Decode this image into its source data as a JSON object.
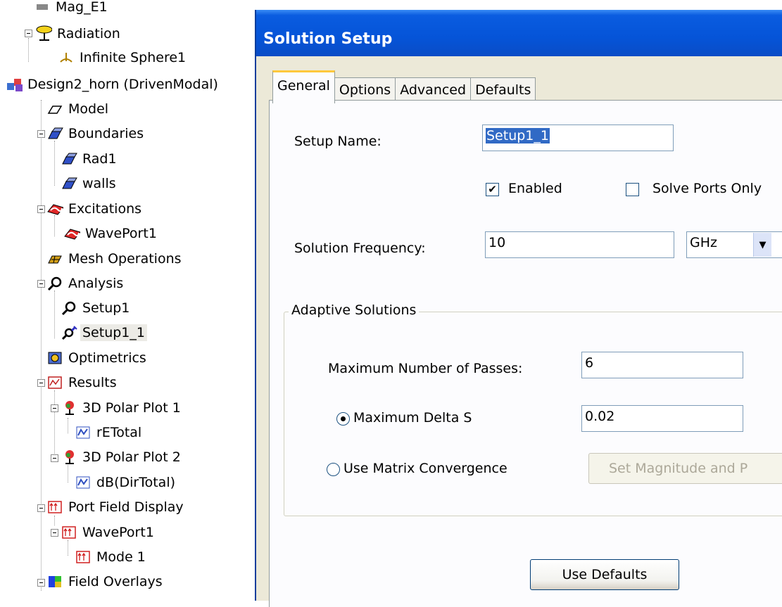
{
  "tree": {
    "items": [
      {
        "label": "Mag_E1"
      },
      {
        "label": "Radiation"
      },
      {
        "label": "Infinite Sphere1"
      },
      {
        "label": "Design2_horn (DrivenModal)"
      },
      {
        "label": "Model"
      },
      {
        "label": "Boundaries"
      },
      {
        "label": "Rad1"
      },
      {
        "label": "walls"
      },
      {
        "label": "Excitations"
      },
      {
        "label": "WavePort1"
      },
      {
        "label": "Mesh Operations"
      },
      {
        "label": "Analysis"
      },
      {
        "label": "Setup1"
      },
      {
        "label": "Setup1_1"
      },
      {
        "label": "Optimetrics"
      },
      {
        "label": "Results"
      },
      {
        "label": "3D Polar Plot 1"
      },
      {
        "label": "rETotal"
      },
      {
        "label": "3D Polar Plot 2"
      },
      {
        "label": "dB(DirTotal)"
      },
      {
        "label": "Port Field Display"
      },
      {
        "label": "WavePort1"
      },
      {
        "label": "Mode 1"
      },
      {
        "label": "Field Overlays"
      }
    ]
  },
  "dialog": {
    "title": "Solution Setup",
    "tabs": [
      "General",
      "Options",
      "Advanced",
      "Defaults"
    ],
    "setup_name_label": "Setup Name:",
    "setup_name_value": "Setup1_1",
    "enabled_label": "Enabled",
    "enabled_checked": true,
    "solve_ports_only_label": "Solve Ports Only",
    "solve_ports_only_checked": false,
    "solution_frequency_label": "Solution Frequency:",
    "solution_frequency_value": "10",
    "frequency_unit": "GHz",
    "adaptive_group_title": "Adaptive Solutions",
    "max_passes_label": "Maximum Number of Passes:",
    "max_passes_value": "6",
    "max_delta_s_label": "Maximum Delta S",
    "max_delta_s_value": "0.02",
    "use_matrix_convergence_label": "Use Matrix Convergence",
    "set_magnitude_button": "Set Magnitude and P",
    "use_defaults_button": "Use Defaults"
  },
  "colors": {
    "titlebar": "#0554d8",
    "dialog_bg": "#ece9d8",
    "selection": "#316ac5",
    "tab_highlight": "#ffc83c"
  }
}
